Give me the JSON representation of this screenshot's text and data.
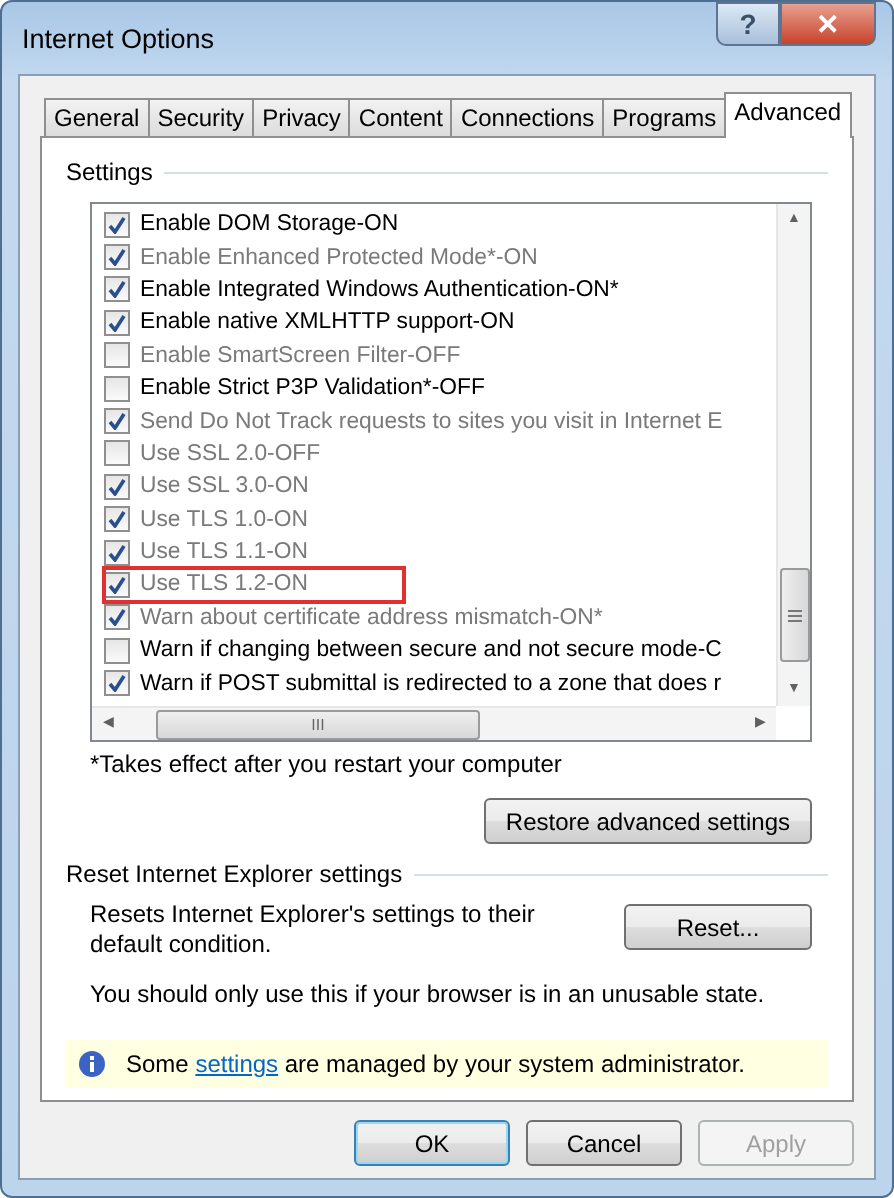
{
  "window": {
    "title": "Internet Options",
    "help_button": "?",
    "close_button": "✕"
  },
  "tabs": [
    {
      "label": "General",
      "selected": false
    },
    {
      "label": "Security",
      "selected": false
    },
    {
      "label": "Privacy",
      "selected": false
    },
    {
      "label": "Content",
      "selected": false
    },
    {
      "label": "Connections",
      "selected": false
    },
    {
      "label": "Programs",
      "selected": false
    },
    {
      "label": "Advanced",
      "selected": true
    }
  ],
  "settings": {
    "title": "Settings",
    "items": [
      {
        "label": "Enable DOM Storage-ON",
        "checked": true,
        "disabled": false,
        "highlighted": false
      },
      {
        "label": "Enable Enhanced Protected Mode*-ON",
        "checked": true,
        "disabled": true,
        "highlighted": false
      },
      {
        "label": "Enable Integrated Windows Authentication-ON*",
        "checked": true,
        "disabled": false,
        "highlighted": false
      },
      {
        "label": "Enable native XMLHTTP support-ON",
        "checked": true,
        "disabled": false,
        "highlighted": false
      },
      {
        "label": "Enable SmartScreen Filter-OFF",
        "checked": false,
        "disabled": true,
        "highlighted": false
      },
      {
        "label": "Enable Strict P3P Validation*-OFF",
        "checked": false,
        "disabled": false,
        "highlighted": false
      },
      {
        "label": "Send Do Not Track requests to sites you visit in Internet E",
        "checked": true,
        "disabled": true,
        "highlighted": false
      },
      {
        "label": "Use SSL 2.0-OFF",
        "checked": false,
        "disabled": true,
        "highlighted": false
      },
      {
        "label": "Use SSL 3.0-ON",
        "checked": true,
        "disabled": true,
        "highlighted": false
      },
      {
        "label": "Use TLS 1.0-ON",
        "checked": true,
        "disabled": true,
        "highlighted": false
      },
      {
        "label": "Use TLS 1.1-ON",
        "checked": true,
        "disabled": true,
        "highlighted": false
      },
      {
        "label": "Use TLS 1.2-ON",
        "checked": true,
        "disabled": true,
        "highlighted": true
      },
      {
        "label": "Warn about certificate address mismatch-ON*",
        "checked": true,
        "disabled": true,
        "highlighted": false
      },
      {
        "label": "Warn if changing between secure and not secure mode-C",
        "checked": false,
        "disabled": false,
        "highlighted": false
      },
      {
        "label": "Warn if POST submittal is redirected to a zone that does r",
        "checked": true,
        "disabled": false,
        "highlighted": false
      }
    ],
    "scroll_arrows": {
      "up": "▲",
      "down": "▼",
      "left": "◀",
      "right": "▶",
      "grip": "III"
    },
    "note": "*Takes effect after you restart your computer",
    "restore_button": "Restore advanced settings"
  },
  "reset": {
    "title": "Reset Internet Explorer settings",
    "description": "Resets Internet Explorer's settings to their default condition.",
    "button": "Reset...",
    "warning": "You should only use this if your browser is in an unusable state."
  },
  "info_bar": {
    "before": "Some ",
    "link": "settings",
    "after": " are managed by your system administrator."
  },
  "buttons": [
    {
      "label": "OK",
      "default": true,
      "disabled": false
    },
    {
      "label": "Cancel",
      "default": false,
      "disabled": false
    },
    {
      "label": "Apply",
      "default": false,
      "disabled": true
    }
  ]
}
